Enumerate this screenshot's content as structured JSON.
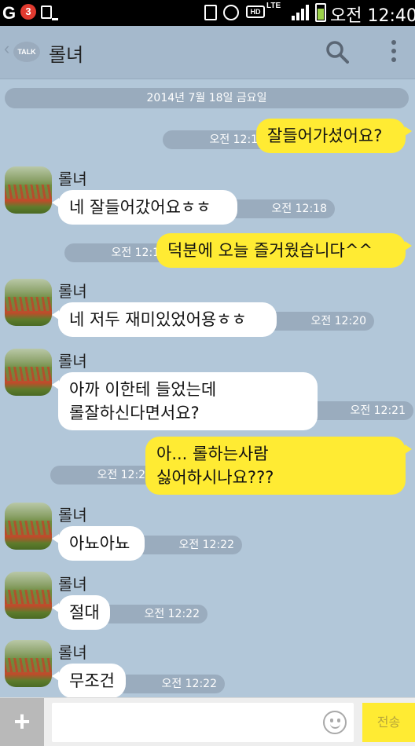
{
  "status_bar": {
    "carrier_logo": "G",
    "notification_count": "3",
    "hd_label": "HD",
    "lte_label": "LTE",
    "clock": "오전 12:40",
    "icons": [
      "image-icon",
      "phone-icon",
      "alarm-icon",
      "signal-icon",
      "battery-icon"
    ]
  },
  "header": {
    "back_icon": "chevron-left-icon",
    "talk_badge": "TALK",
    "title": "롤녀",
    "icons": [
      "search-icon",
      "more-vertical-icon"
    ]
  },
  "date_divider": "2014년 7월 18일 금요일",
  "messages": [
    {
      "side": "out",
      "text": "잘들어가셨어요?",
      "time": "오전 12:17"
    },
    {
      "side": "in",
      "sender": "롤녀",
      "text": "네 잘들어갔어요ㅎㅎ",
      "time": "오전 12:18"
    },
    {
      "side": "out",
      "text": "덕분에 오늘 즐거웠습니다^^",
      "time": "오전 12:19"
    },
    {
      "side": "in",
      "sender": "롤녀",
      "text": "네 저두 재미있었어용ㅎㅎ",
      "time": "오전 12:20"
    },
    {
      "side": "in",
      "sender": "롤녀",
      "text_lines": [
        "아까 이한테 들었는데",
        "롤잘하신다면서요?"
      ],
      "time": "오전 12:21"
    },
    {
      "side": "out",
      "text_lines": [
        "아... 롤하는사람",
        "싫어하시나요???"
      ],
      "time": "오전 12:22"
    },
    {
      "side": "in",
      "sender": "롤녀",
      "text": "아뇨아뇨",
      "time": "오전 12:22"
    },
    {
      "side": "in",
      "sender": "롤녀",
      "text": "절대",
      "time": "오전 12:22"
    },
    {
      "side": "in",
      "sender": "롤녀",
      "text": "무조건",
      "time": "오전 12:22"
    }
  ],
  "input_bar": {
    "plus_label": "+",
    "placeholder": "",
    "value": "",
    "send_label": "전송",
    "emoticon_icon": "smiley-icon"
  },
  "colors": {
    "chat_background": "#b2c7d9",
    "outgoing_bubble": "#ffeb33",
    "incoming_bubble": "#ffffff",
    "header": "#a5b9cc"
  }
}
